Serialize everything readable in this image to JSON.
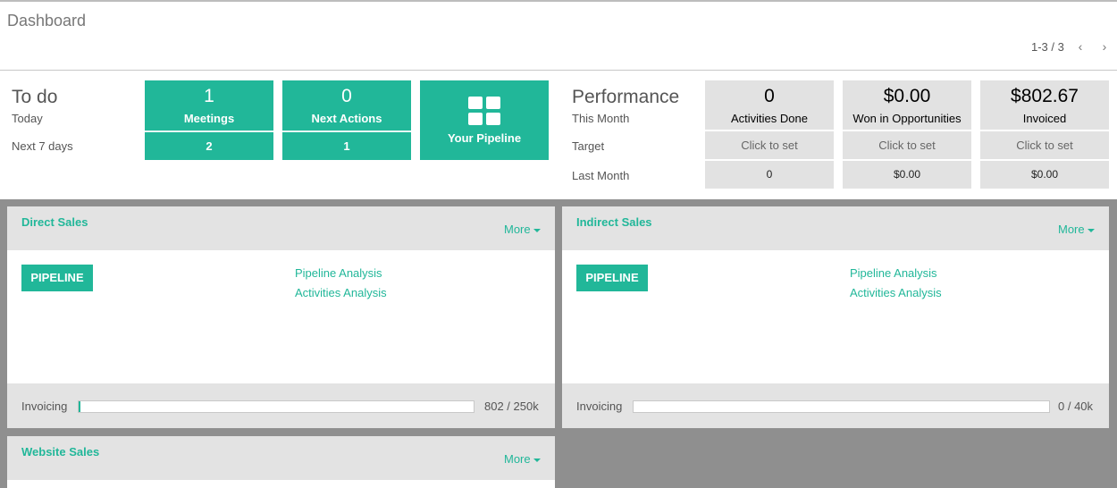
{
  "header": {
    "title": "Dashboard",
    "pager": "1-3 / 3",
    "prev_icon": "‹",
    "next_icon": "›"
  },
  "todo": {
    "title": "To do",
    "today_label": "Today",
    "next7_label": "Next 7 days",
    "meetings": {
      "count": "1",
      "label": "Meetings",
      "next7": "2"
    },
    "next_actions": {
      "count": "0",
      "label": "Next Actions",
      "next7": "1"
    },
    "pipeline": {
      "label": "Your Pipeline",
      "icon": "grid-icon"
    }
  },
  "performance": {
    "title": "Performance",
    "this_month_label": "This Month",
    "target_label": "Target",
    "last_month_label": "Last Month",
    "tiles": [
      {
        "value": "0",
        "label": "Activities Done",
        "target": "Click to set",
        "last_month": "0"
      },
      {
        "value": "$0.00",
        "label": "Won in Opportunities",
        "target": "Click to set",
        "last_month": "$0.00"
      },
      {
        "value": "$802.67",
        "label": "Invoiced",
        "target": "Click to set",
        "last_month": "$0.00"
      }
    ]
  },
  "teams": [
    {
      "name": "Direct Sales",
      "more": "More",
      "pipeline": "PIPELINE",
      "links": [
        "Pipeline Analysis",
        "Activities Analysis"
      ],
      "invoicing_label": "Invoicing",
      "invoicing_value": "802 / 250k",
      "invoicing_fraction": 0.0032
    },
    {
      "name": "Indirect Sales",
      "more": "More",
      "pipeline": "PIPELINE",
      "links": [
        "Pipeline Analysis",
        "Activities Analysis"
      ],
      "invoicing_label": "Invoicing",
      "invoicing_value": "0 / 40k",
      "invoicing_fraction": 0
    },
    {
      "name": "Website Sales",
      "more": "More"
    }
  ],
  "colors": {
    "accent": "#21b799",
    "tile_gray": "#e2e2e2",
    "background": "#8f8f8f"
  }
}
